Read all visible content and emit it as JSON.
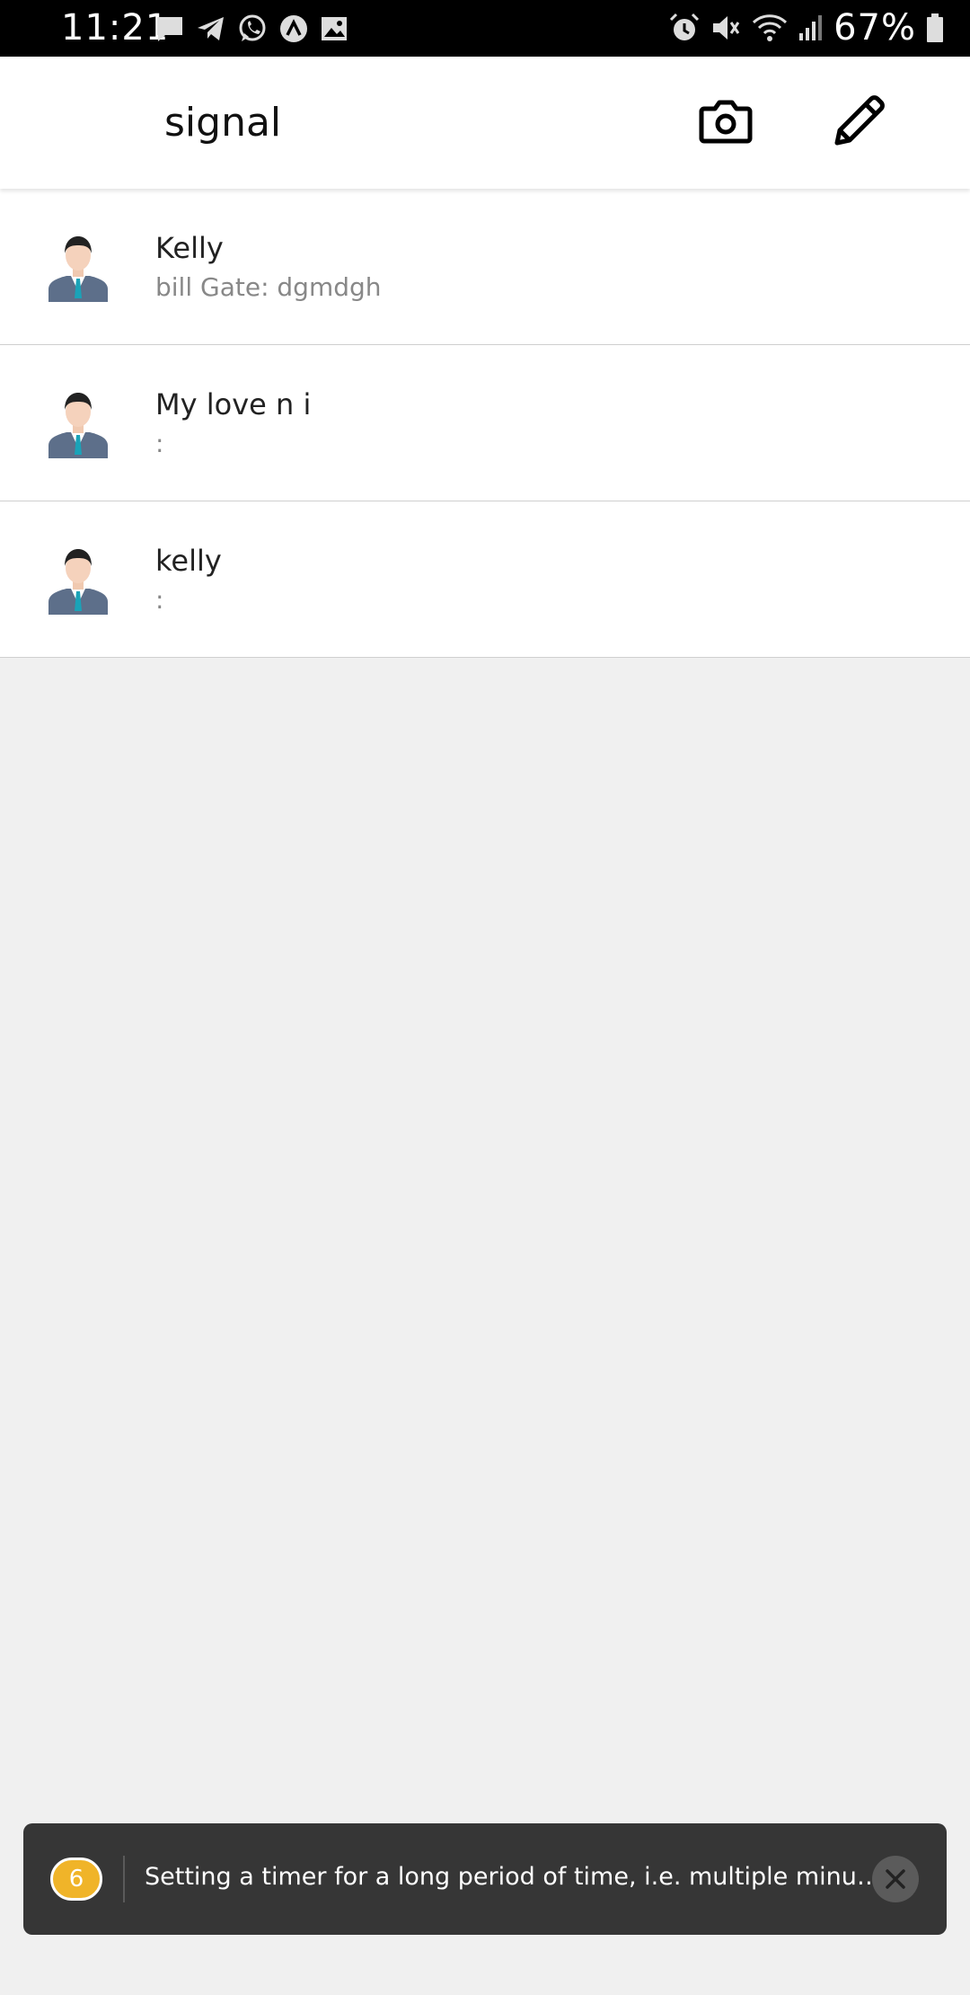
{
  "status_bar": {
    "time": "11:21",
    "battery": "67%",
    "left_icons": [
      "message-icon",
      "telegram-icon",
      "whatsapp-icon",
      "arch-icon",
      "image-icon"
    ],
    "right_icons": [
      "alarm-icon",
      "mute-icon",
      "wifi-icon",
      "signal-icon",
      "battery-icon"
    ]
  },
  "app_bar": {
    "title": "signal",
    "actions": [
      "camera-icon",
      "pencil-icon"
    ]
  },
  "chats": [
    {
      "name": "Kelly",
      "preview": "bill Gate: dgmdgh"
    },
    {
      "name": "My love n i",
      "preview": ":"
    },
    {
      "name": "kelly",
      "preview": ":"
    }
  ],
  "toast": {
    "count": "6",
    "message": "Setting a timer for a long period of time, i.e. multiple minutes...",
    "badge_color": "#f0b429"
  },
  "colors": {
    "background": "#f0f0f0",
    "toast_background": "#363636"
  }
}
